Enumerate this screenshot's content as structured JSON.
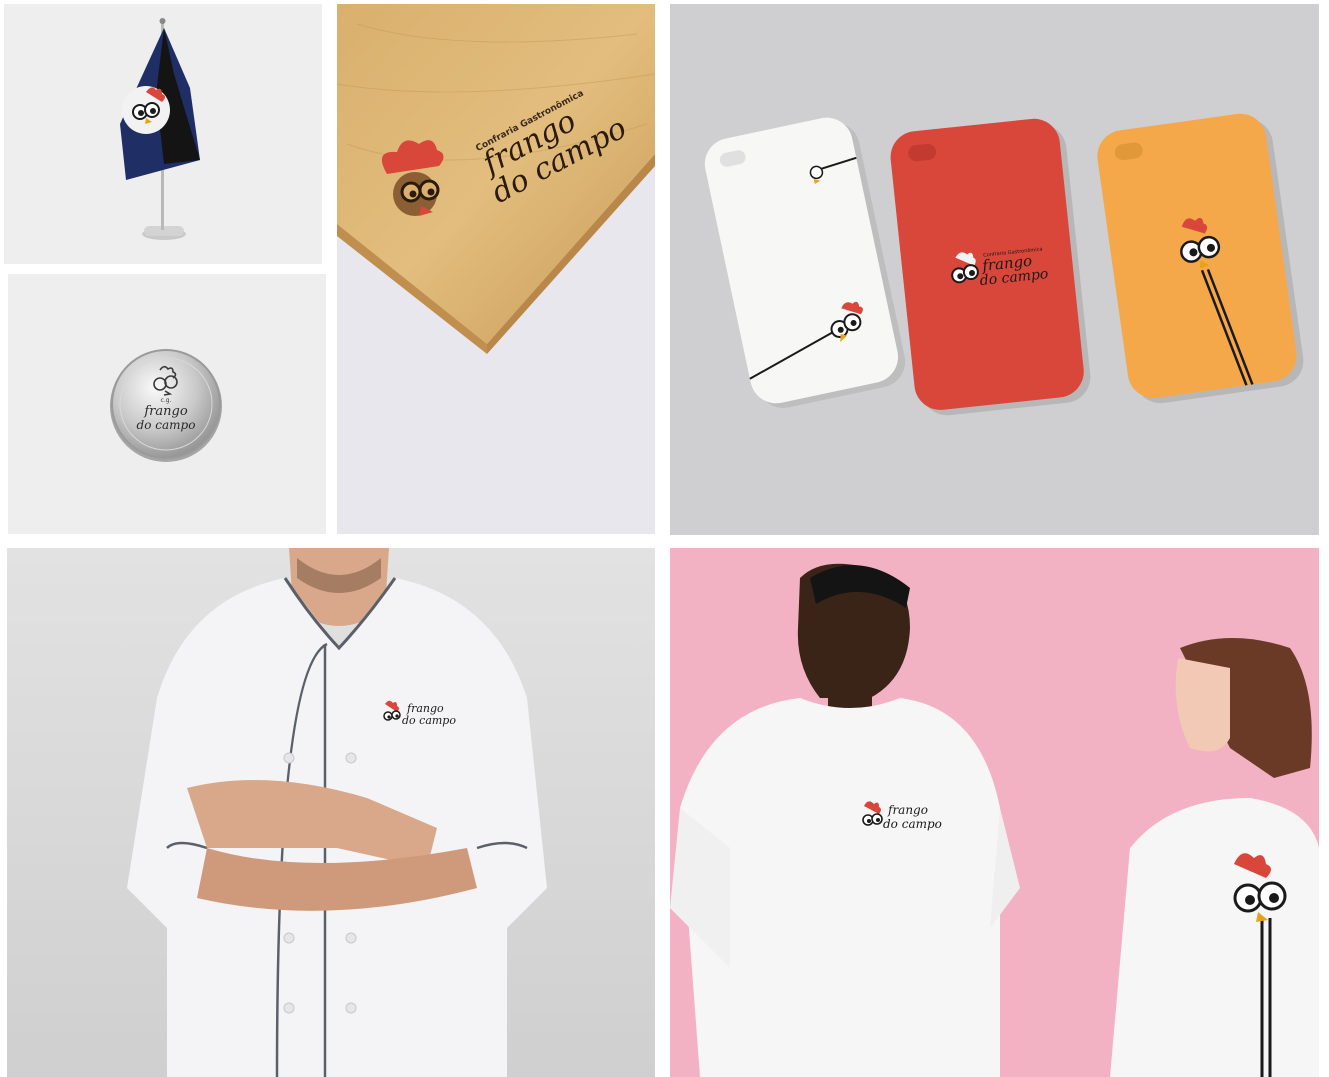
{
  "brand": {
    "tagline": "Confraria Gastronômica",
    "name_line1": "frango",
    "name_line2": "do campo",
    "initials": "c.g.",
    "colors": {
      "red": "#d9463a",
      "black": "#1a1a1a",
      "orange": "#f5a84a",
      "beak": "#e8a21a",
      "navy": "#1f2f66",
      "pink": "#f2b2c4"
    }
  },
  "mockups": {
    "flag": {
      "label": "table-flag"
    },
    "pin": {
      "label": "silver-pin-badge"
    },
    "wood": {
      "label": "wood-board-engraving"
    },
    "phones": {
      "label": "phone-cases",
      "case_colors": [
        "#f7f7f5",
        "#d9463a",
        "#f5a84a"
      ]
    },
    "chef": {
      "label": "chef-jacket"
    },
    "tshirts": {
      "label": "t-shirts"
    }
  }
}
